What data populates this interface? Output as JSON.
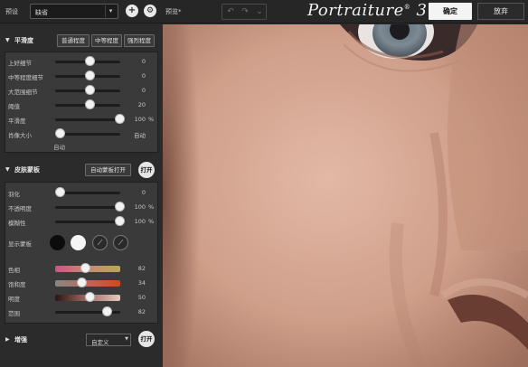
{
  "topbar": {
    "preset_label": "预设",
    "preset_value": "缺省",
    "add_symbol": "+",
    "settings_symbol": "⚙",
    "preview_label": "预览*",
    "app_name": "Portraiture",
    "app_mark": "®",
    "app_version": "3",
    "ok_label": "确定",
    "cancel_label": "放弃"
  },
  "smoothing": {
    "title": "平滑度",
    "presets": [
      "普通程度",
      "中等程度",
      "强烈程度"
    ],
    "rows": [
      {
        "label": "上好细节",
        "value": "0",
        "unit": "",
        "pos": 0.5
      },
      {
        "label": "中等程度细节",
        "value": "0",
        "unit": "",
        "pos": 0.5
      },
      {
        "label": "大范围细节",
        "value": "0",
        "unit": "",
        "pos": 0.5
      },
      {
        "label": "阈值",
        "value": "20",
        "unit": "",
        "pos": 0.5
      },
      {
        "label": "平滑度",
        "value": "100",
        "unit": "%",
        "pos": 1.0
      },
      {
        "label": "肖像大小",
        "value": "自动",
        "unit": "",
        "pos": 0.0
      }
    ],
    "auto_sub": "自动"
  },
  "skin_mask": {
    "title": "皮肤蒙板",
    "auto_button": "自动蒙板打开",
    "toggle": "打开",
    "rows": [
      {
        "label": "羽化",
        "value": "0",
        "unit": "",
        "pos": 0.0
      },
      {
        "label": "不透明度",
        "value": "100",
        "unit": "%",
        "pos": 1.0
      },
      {
        "label": "模糊性",
        "value": "100",
        "unit": "%",
        "pos": 1.0
      }
    ],
    "show_mask_label": "显示蒙板",
    "swatch_colors": [
      "#0c0c0c",
      "#f5f5f5"
    ],
    "color_rows": [
      {
        "label": "色相",
        "value": "82",
        "pos": 0.43
      },
      {
        "label": "饱和度",
        "value": "34",
        "pos": 0.36
      },
      {
        "label": "明度",
        "value": "50",
        "pos": 0.5
      },
      {
        "label": "范围",
        "value": "82",
        "pos": 0.79
      }
    ]
  },
  "enhance": {
    "title": "增强",
    "select_value": "自定义",
    "toggle": "打开"
  }
}
